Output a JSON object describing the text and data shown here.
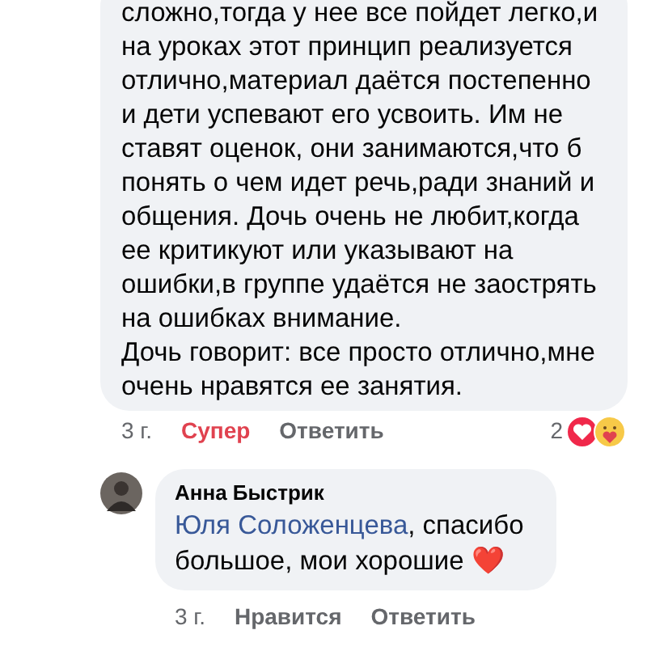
{
  "comment": {
    "lines": [
      "сложно,тогда у нее все пойдет легко,и",
      "на уроках этот принцип реализуется",
      "отлично,материал даётся постепенно",
      "и дети успевают его усвоить. Им не",
      "ставят оценок, они занимаются,что б",
      "понять о чем идет речь,ради знаний и",
      "общения. Дочь очень не любит,когда",
      "ее критикуют или указывают на",
      "ошибки,в группе удаётся не заострять",
      "на ошибках внимание.",
      "Дочь говорит: все просто отлично,мне",
      "очень нравятся ее занятия."
    ],
    "time": "3 г.",
    "reaction_label": "Супер",
    "reacted": true,
    "reply_label": "Ответить",
    "reaction_count": "2"
  },
  "reply": {
    "author": "Анна Быстрик",
    "mention": "Юля Соложенцева",
    "text": ", спасибо большое, мои хорошие",
    "emoji": "❤️",
    "time": "3 г.",
    "like_label": "Нравится",
    "reacted": false,
    "reply_label": "Ответить"
  }
}
